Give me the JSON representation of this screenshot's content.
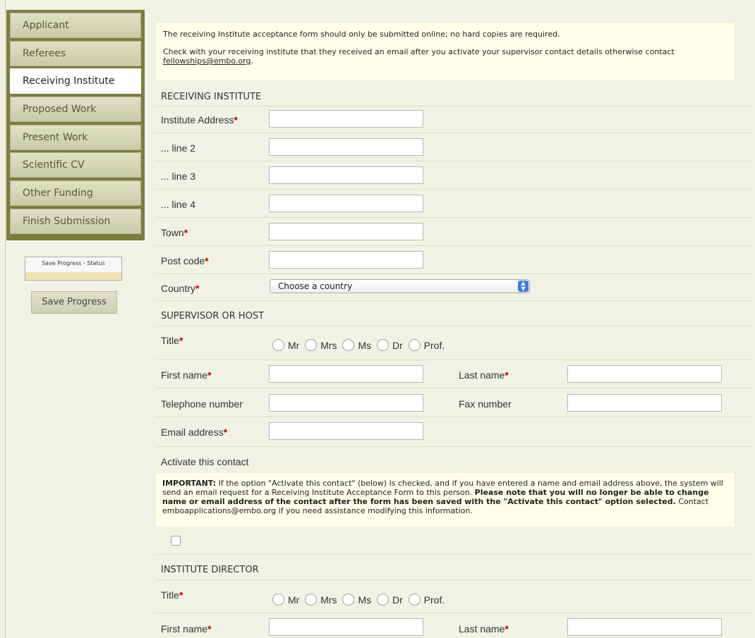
{
  "sidebar": {
    "items": [
      {
        "label": "Applicant"
      },
      {
        "label": "Referees"
      },
      {
        "label": "Receiving Institute"
      },
      {
        "label": "Proposed Work"
      },
      {
        "label": "Present Work"
      },
      {
        "label": "Scientific CV"
      },
      {
        "label": "Other Funding"
      },
      {
        "label": "Finish Submission"
      }
    ],
    "active_index": 2,
    "status_label": "Save Progress - Status",
    "save_button": "Save Progress"
  },
  "notice": {
    "line1": "The receiving Institute acceptance form should only be submitted online; no hard copies are required.",
    "line2": "Check with your receiving institute that they received an email after you activate your supervisor contact details otherwise contact",
    "email": "fellowships@embo.org",
    "email_suffix": "."
  },
  "receiving_institute": {
    "title": "RECEIVING INSTITUTE",
    "address": "Institute Address",
    "line2": "... line 2",
    "line3": "... line 3",
    "line4": "... line 4",
    "town": "Town",
    "postcode": "Post code",
    "country": "Country",
    "country_placeholder": "Choose a country"
  },
  "supervisor": {
    "title": "SUPERVISOR OR HOST",
    "title_label": "Title",
    "titles": [
      "Mr",
      "Mrs",
      "Ms",
      "Dr",
      "Prof."
    ],
    "first_name": "First name",
    "last_name": "Last name",
    "telephone": "Telephone number",
    "fax": "Fax number",
    "email": "Email address",
    "activate": "Activate this contact"
  },
  "important": {
    "lead": "IMPORTANT:",
    "text1": " If the option \"Activate this contact\" (below) is checked, and if you have entered a name and email address above, the system will send an email request for a Receiving Institute Acceptance Form to this person. ",
    "bold": "Please note that you will no longer be able to change name or email address of the contact after the form has been saved with the \"Activate this contact\" option selected.",
    "text2": " Contact emboapplications@embo.org if you need assistance modifying this information."
  },
  "director": {
    "title": "INSTITUTE DIRECTOR",
    "title_label": "Title",
    "titles": [
      "Mr",
      "Mrs",
      "Ms",
      "Dr",
      "Prof."
    ],
    "first_name": "First name",
    "last_name": "Last name"
  },
  "required_marker": "*"
}
